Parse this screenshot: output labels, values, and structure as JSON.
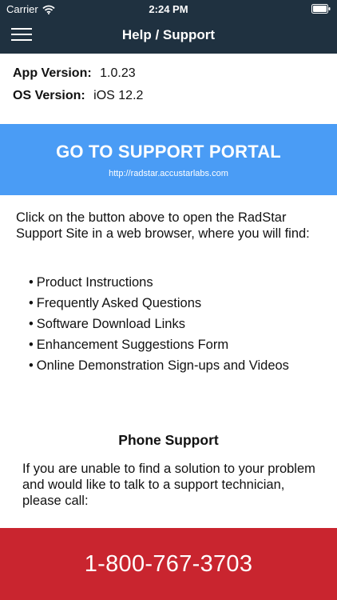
{
  "status_bar": {
    "carrier": "Carrier",
    "time": "2:24 PM",
    "wifi_icon": "wifi-icon",
    "battery_icon": "battery-icon"
  },
  "nav": {
    "title": "Help / Support",
    "menu_icon": "hamburger-menu-icon"
  },
  "info": {
    "app_version_label": "App Version:",
    "app_version_value": "1.0.23",
    "os_version_label": "OS Version:",
    "os_version_value": "iOS 12.2"
  },
  "portal": {
    "label": "GO TO SUPPORT PORTAL",
    "url": "http://radstar.accustarlabs.com"
  },
  "intro": "Click on the button above to open the RadStar Support Site in a web browser, where you will find:",
  "features": [
    "Product Instructions",
    "Frequently Asked Questions",
    "Software Download Links",
    "Enhancement Suggestions Form",
    "Online Demonstration Sign-ups and Videos"
  ],
  "phone": {
    "heading": "Phone Support",
    "text": "If you are unable to find a solution to your problem and would like to talk to a support technician, please call:",
    "number": "1-800-767-3703"
  },
  "colors": {
    "nav_background": "#1f3140",
    "portal_button": "#4a9cf5",
    "phone_button": "#c9252f"
  }
}
